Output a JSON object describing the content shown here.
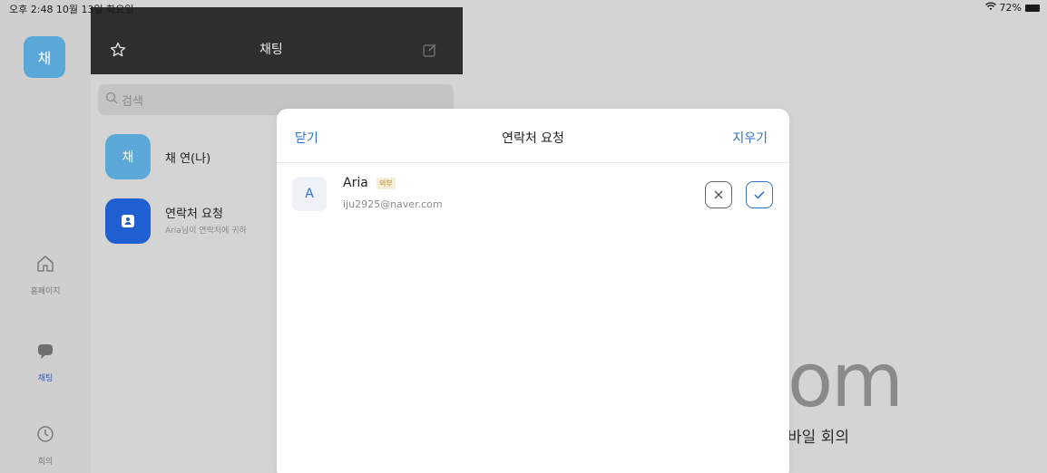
{
  "status_bar": {
    "time": "오후 2:48  10월 13일 화요일",
    "battery": "72%"
  },
  "rail": {
    "avatar_initial": "채",
    "items": [
      {
        "label": "홈페이지",
        "icon": "home-icon"
      },
      {
        "label": "채팅",
        "icon": "chat-bubble-icon"
      },
      {
        "label": "회의",
        "icon": "clock-icon"
      }
    ]
  },
  "chat_panel": {
    "title": "채팅",
    "search_placeholder": "검색",
    "chats": [
      {
        "initial": "채",
        "name": "채 연(나)",
        "subtitle": "",
        "color": "#5ba8d8"
      },
      {
        "initial": "",
        "name": "연락처 요청",
        "subtitle": "Aria님이 연락처에 귀하",
        "color": "#1f5fd1"
      }
    ]
  },
  "background": {
    "logo_text": "om",
    "subtitle": "바일 회의"
  },
  "modal": {
    "close_label": "닫기",
    "title": "연락처 요청",
    "clear_label": "지우기",
    "request": {
      "initial": "A",
      "name": "Aria",
      "badge": "외부",
      "email": "iju2925@naver.com"
    }
  },
  "colors": {
    "accent": "#2f72c9",
    "header_dark": "#2e2e2f"
  }
}
